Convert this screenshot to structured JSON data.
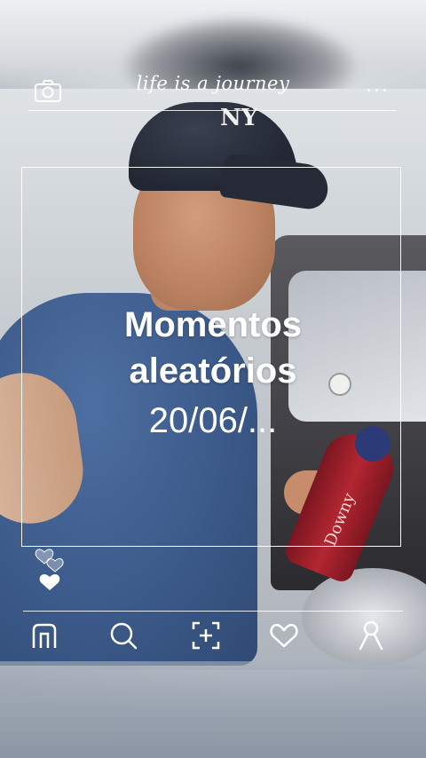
{
  "header": {
    "tagline": "life is a journey",
    "left_icon": "camera-icon",
    "right_icon": "more-icon",
    "more_label": "..."
  },
  "post": {
    "title_line1": "Momentos",
    "title_line2": "aleatórios",
    "date": "20/06/..."
  },
  "photo": {
    "cap_logo": "NY",
    "bottle_label": "Downy"
  },
  "reactions": {
    "icons": [
      "heart-outline-icon",
      "heart-outline-icon",
      "heart-filled-icon"
    ]
  },
  "nav": {
    "items": [
      {
        "name": "home",
        "icon": "home-icon"
      },
      {
        "name": "search",
        "icon": "search-icon"
      },
      {
        "name": "add",
        "icon": "add-square-icon"
      },
      {
        "name": "likes",
        "icon": "heart-icon"
      },
      {
        "name": "profile",
        "icon": "profile-icon"
      }
    ]
  },
  "colors": {
    "overlay": "#ffffff",
    "shirt": "#3c5a8a",
    "cap": "#222733",
    "bottle": "#b32631"
  }
}
